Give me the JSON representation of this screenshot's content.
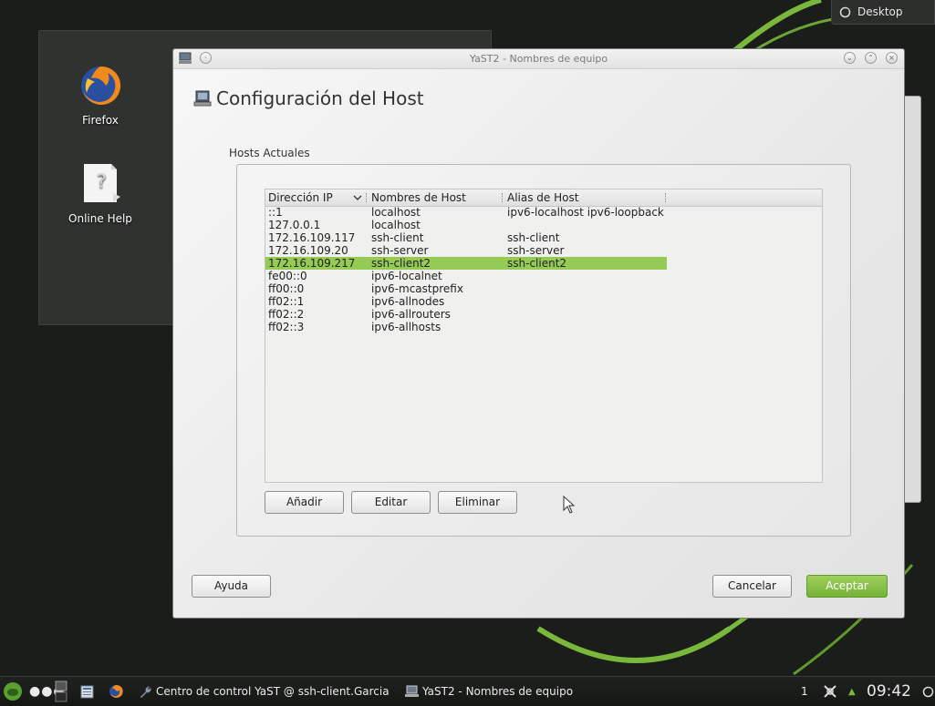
{
  "desktop": {
    "icons": [
      {
        "label": "Firefox",
        "icon": "firefox-icon"
      },
      {
        "label": "Online Help",
        "icon": "help-document-icon"
      }
    ],
    "widget_label": "Desktop"
  },
  "window": {
    "title": "YaST2 - Nombres de equipo",
    "heading": "Configuración del Host",
    "group_label": "Hosts Actuales",
    "table": {
      "columns": [
        "Dirección IP",
        "Nombres de Host",
        "Alias de Host"
      ],
      "sort_indicator": "chevron-down-icon",
      "rows": [
        {
          "ip": "::1",
          "host": "localhost",
          "alias": "ipv6-localhost ipv6-loopback"
        },
        {
          "ip": "127.0.0.1",
          "host": "localhost",
          "alias": ""
        },
        {
          "ip": "172.16.109.117",
          "host": "ssh-client",
          "alias": "ssh-client"
        },
        {
          "ip": "172.16.109.20",
          "host": "ssh-server",
          "alias": "ssh-server"
        },
        {
          "ip": "172.16.109.217",
          "host": "ssh-client2",
          "alias": "ssh-client2"
        },
        {
          "ip": "fe00::0",
          "host": "ipv6-localnet",
          "alias": ""
        },
        {
          "ip": "ff00::0",
          "host": "ipv6-mcastprefix",
          "alias": ""
        },
        {
          "ip": "ff02::1",
          "host": "ipv6-allnodes",
          "alias": ""
        },
        {
          "ip": "ff02::2",
          "host": "ipv6-allrouters",
          "alias": ""
        },
        {
          "ip": "ff02::3",
          "host": "ipv6-allhosts",
          "alias": ""
        }
      ],
      "selected_row": 4
    },
    "buttons": {
      "add": "Añadir",
      "edit": "Editar",
      "delete": "Eliminar",
      "help": "Ayuda",
      "cancel": "Cancelar",
      "accept": "Aceptar"
    }
  },
  "taskbar": {
    "tasks": [
      {
        "label": "Centro de control YaST @ ssh-client.Garcia",
        "icon": "wrench-icon"
      },
      {
        "label": "YaST2 - Nombres de equipo",
        "icon": "computer-icon"
      }
    ],
    "pager": "1",
    "clock": "09:42"
  },
  "colors": {
    "selection": "#95cb55",
    "accent_green": "#7ab83c",
    "desktop_bg": "#1b1d1b"
  }
}
